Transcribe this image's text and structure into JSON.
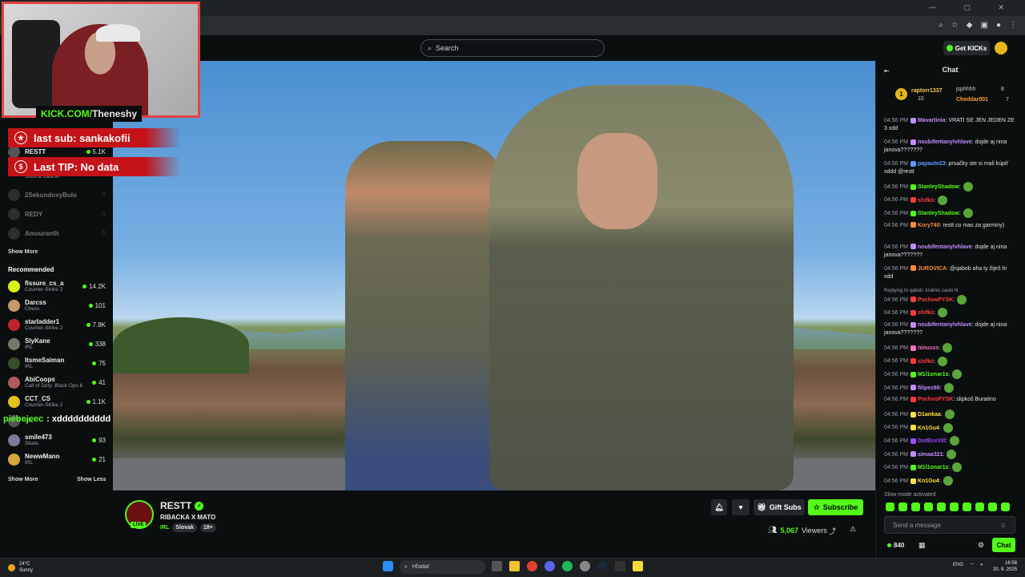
{
  "browser": {
    "window_controls": "— ▢ ✕"
  },
  "topnav": {
    "search_placeholder": "Search",
    "get_kicks": "Get KICKs"
  },
  "sidebar": {
    "following": [
      {
        "name": "RESTT",
        "category": "",
        "count": "5.1K",
        "live": true
      },
      {
        "name": "",
        "category": "Slots & Casino",
        "count": "",
        "live": true
      },
      {
        "name": "2SekundovyBulo",
        "category": "",
        "count": "",
        "live": false
      },
      {
        "name": "REDY",
        "category": "",
        "count": "",
        "live": false
      },
      {
        "name": "Amouranth",
        "category": "",
        "count": "",
        "live": false
      }
    ],
    "show_more_1": "Show More",
    "recommended_heading": "Recommended",
    "recommended": [
      {
        "name": "fissure_cs_a",
        "category": "Counter-Strike 2",
        "count": "14.2K",
        "avatar_color": "#d9f21a"
      },
      {
        "name": "Darcss",
        "category": "Chess",
        "count": "101",
        "avatar_color": "#c89a6a"
      },
      {
        "name": "starladder1",
        "category": "Counter-Strike 2",
        "count": "7.8K",
        "avatar_color": "#c0242b"
      },
      {
        "name": "SlyKane",
        "category": "IRL",
        "count": "338",
        "avatar_color": "#6f7a6a"
      },
      {
        "name": "ItsmeSaiman",
        "category": "IRL",
        "count": "75",
        "avatar_color": "#3a4d2a"
      },
      {
        "name": "AbiCoops",
        "category": "Call of Duty: Black Ops 6",
        "count": "41",
        "avatar_color": "#b15b5b"
      },
      {
        "name": "CCT_CS",
        "category": "Counter-Strike 2",
        "count": "1.1K",
        "avatar_color": "#e5c21b"
      },
      {
        "name": "",
        "category": "IRL",
        "count": "",
        "avatar_color": "#555555"
      },
      {
        "name": "smile473",
        "category": "Skate.",
        "count": "93",
        "avatar_color": "#7a7a9a"
      },
      {
        "name": "NewwMann",
        "category": "IRL",
        "count": "21",
        "avatar_color": "#d4a73a"
      }
    ],
    "show_more_2": "Show More",
    "show_less": "Show Less"
  },
  "overlay": {
    "kick_domain": "KICK.COM/",
    "kick_user": "Theneshy",
    "last_sub": "last sub: sankakofii",
    "last_tip": "Last TIP: No data",
    "chat_popup_user": "piebejeec",
    "chat_popup_msg": ": xdddddddddd"
  },
  "stream": {
    "channel": "RESTT",
    "live_label": "LIVE",
    "title": "RIBACKA X MATO",
    "category": "IRL",
    "tags": [
      "Slovak",
      "18+"
    ],
    "gift_subs": "Gift Subs",
    "subscribe": "Subscribe",
    "viewers": "5,067",
    "viewers_label": "Viewers"
  },
  "chat": {
    "title": "Chat",
    "leaderboard": [
      {
        "rank": "1",
        "name": "raptorr1337",
        "value": "10",
        "gifts": ""
      },
      {
        "rank": "",
        "name": "jsphhhh",
        "value": "8"
      },
      {
        "rank": "",
        "name": "Cheddar001",
        "value": "7"
      }
    ],
    "messages": [
      {
        "time": "04:56 PM",
        "user": "Mavartinia",
        "color": "#c38cff",
        "text": ": VRATI SE JEN JEDEN ZE 3 xdd"
      },
      {
        "time": "04:56 PM",
        "user": "noubifentanylvhlave",
        "color": "#c38cff",
        "text": ": dojde aj nina janova???????"
      },
      {
        "time": "04:56 PM",
        "user": "papaute23",
        "color": "#5d9bff",
        "text": ": prsačky ste si mali kúpiť xddd @restt"
      },
      {
        "time": "04:56 PM",
        "user": "StanleyShadow",
        "color": "#53fc18",
        "text": ":"
      },
      {
        "time": "04:56 PM",
        "user": "shifkii",
        "color": "#ff3b3b",
        "text": ":"
      },
      {
        "time": "04:56 PM",
        "user": "StanleyShadow",
        "color": "#53fc18",
        "text": ":"
      },
      {
        "time": "04:56 PM",
        "user": "Kory740",
        "color": "#ff8c3a",
        "text": ": restt co mas za garminy)"
      },
      {
        "time": "04:56 PM",
        "user": "noubifentanylvhlave",
        "color": "#c38cff",
        "text": ": dojde aj nina janova???????"
      },
      {
        "time": "04:56 PM",
        "user": "JUROVICA",
        "color": "#ff8c3a",
        "text": ": @qabob aha ty žiješ hi xdd"
      },
      {
        "time": "04:56 PM",
        "user": "PochvoPYSK",
        "color": "#ff3b3b",
        "text": ":",
        "reply": "Replying to qabob: kralinis cauki hi"
      },
      {
        "time": "04:56 PM",
        "user": "shifkii",
        "color": "#ff3b3b",
        "text": ":"
      },
      {
        "time": "04:56 PM",
        "user": "noubifentanylvhlave",
        "color": "#c38cff",
        "text": ": dojde aj nina janova???????"
      },
      {
        "time": "04:56 PM",
        "user": "ninusss",
        "color": "#ff6fb5",
        "text": ":"
      },
      {
        "time": "04:56 PM",
        "user": "shifkii",
        "color": "#ff3b3b",
        "text": ":"
      },
      {
        "time": "04:56 PM",
        "user": "M1l1onar1s",
        "color": "#53fc18",
        "text": ":"
      },
      {
        "time": "04:56 PM",
        "user": "filipez66",
        "color": "#c38cff",
        "text": ":"
      },
      {
        "time": "04:56 PM",
        "user": "PochvoPYSK",
        "color": "#ff3b3b",
        "text": ": slipkoš Buratino"
      },
      {
        "time": "04:56 PM",
        "user": "D1ankaa",
        "color": "#ffe03a",
        "text": ":"
      },
      {
        "time": "04:56 PM",
        "user": "Kn1Gu4",
        "color": "#ffe03a",
        "text": ":"
      },
      {
        "time": "04:56 PM",
        "user": "DotBsxVill",
        "color": "#9b4dff",
        "text": ":"
      },
      {
        "time": "04:56 PM",
        "user": "simaa321",
        "color": "#c38cff",
        "text": ":"
      },
      {
        "time": "04:56 PM",
        "user": "M1l1onar1s",
        "color": "#53fc18",
        "text": ":"
      },
      {
        "time": "04:56 PM",
        "user": "Kn1Gu4",
        "color": "#ffe03a",
        "text": ":"
      }
    ],
    "slow_mode": "Slow mode activated",
    "input_placeholder": "Send a message",
    "kicks_balance": "840",
    "chat_button": "Chat"
  },
  "taskbar": {
    "weather_temp": "24°C",
    "weather_desc": "Sunny",
    "search_placeholder": "Hľadať",
    "lang": "ENG",
    "time": "16:56",
    "date": "20. 9. 2025"
  }
}
